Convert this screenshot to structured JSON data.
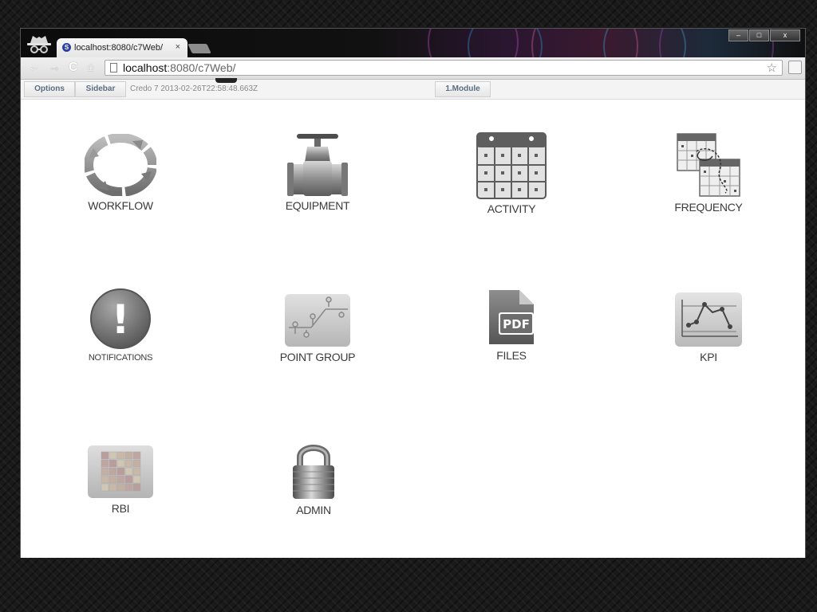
{
  "browser": {
    "tab_title": "localhost:8080/c7Web/",
    "tab_close": "×",
    "url_host": "localhost",
    "url_rest": ":8080/c7Web/",
    "window_minimize": "–",
    "window_maximize": "□",
    "window_close": "x",
    "nav_back": "←",
    "nav_forward": "→",
    "nav_reload": "C",
    "nav_home": "⌂",
    "bookmark_star": "☆"
  },
  "app_bar": {
    "options_label": "Options",
    "sidebar_label": "Sidebar",
    "status_text": "Credo 7 2013-02-26T22:58:48.663Z",
    "module_label": "1.Module"
  },
  "tiles": [
    {
      "label": "WORKFLOW",
      "icon": "workflow-cycle-icon"
    },
    {
      "label": "EQUIPMENT",
      "icon": "valve-icon"
    },
    {
      "label": "ACTIVITY",
      "icon": "calendar-icon"
    },
    {
      "label": "FREQUENCY",
      "icon": "calendar-frequency-icon"
    },
    {
      "label": "NOTIFICATIONS",
      "icon": "exclamation-icon"
    },
    {
      "label": "POINT GROUP",
      "icon": "point-group-icon"
    },
    {
      "label": "FILES",
      "icon": "pdf-file-icon"
    },
    {
      "label": "KPI",
      "icon": "kpi-chart-icon"
    },
    {
      "label": "RBI",
      "icon": "risk-matrix-icon"
    },
    {
      "label": "ADMIN",
      "icon": "padlock-icon"
    }
  ],
  "pdf_icon_text": "PDF",
  "notification_mark": "!",
  "colors": {
    "icon_gray": "#7d7d7d",
    "label_text": "#3a3a3a",
    "app_button_text": "#5a6e82"
  }
}
